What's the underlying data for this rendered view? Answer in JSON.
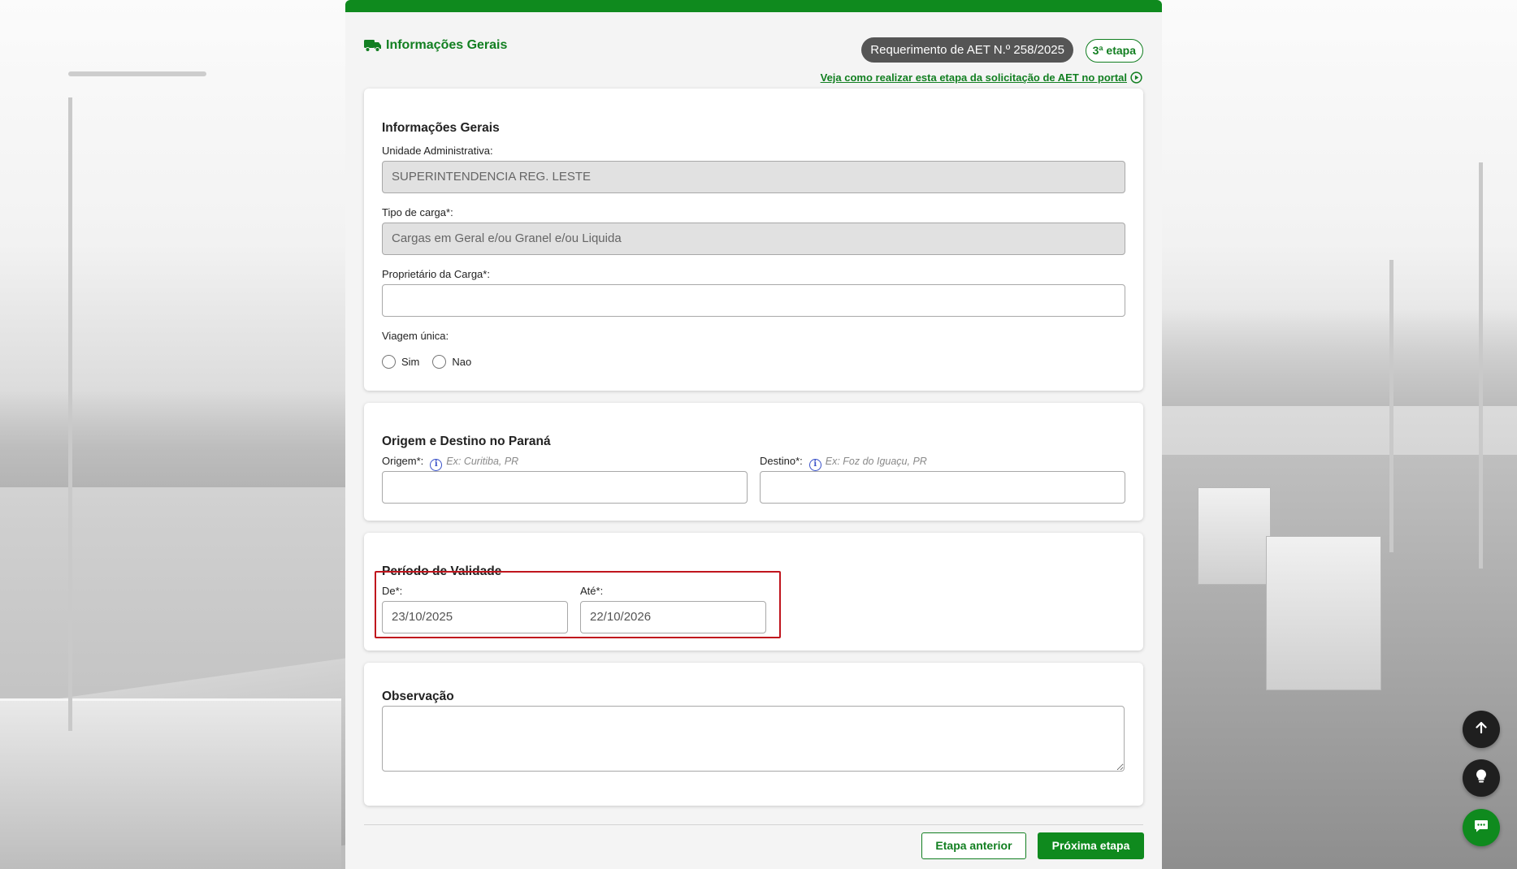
{
  "header": {
    "section_title": "Informações Gerais",
    "request_badge": "Requerimento de AET N.º 258/2025",
    "step_badge": "3ª etapa",
    "help_link": "Veja como realizar esta etapa da solicitação de AET no portal"
  },
  "general_info": {
    "title": "Informações Gerais",
    "admin_unit_label": "Unidade Administrativa:",
    "admin_unit_value": "SUPERINTENDENCIA REG. LESTE",
    "cargo_type_label": "Tipo de carga*:",
    "cargo_type_value": "Cargas em Geral e/ou Granel e/ou Liquida",
    "cargo_owner_label": "Proprietário da Carga*:",
    "cargo_owner_value": "",
    "single_trip_label": "Viagem única:",
    "single_trip_options": [
      "Sim",
      "Nao"
    ]
  },
  "route": {
    "title": "Origem e Destino no Paraná",
    "origin_label": "Origem*:",
    "origin_hint": "Ex: Curitiba, PR",
    "destination_label": "Destino*:",
    "destination_hint": "Ex: Foz do Iguaçu, PR"
  },
  "validity": {
    "title": "Período de Validade",
    "from_label": "De*:",
    "from_value": "23/10/2025",
    "to_label": "Até*:",
    "to_value": "22/10/2026"
  },
  "notes": {
    "title": "Observação"
  },
  "footer": {
    "prev_label": "Etapa anterior",
    "next_label": "Próxima etapa"
  },
  "colors": {
    "brand_green": "#0f8a1e",
    "badge_gray": "#555555",
    "highlight_red": "#c0151d"
  },
  "icons": [
    "truck-icon",
    "play-circle-icon",
    "info-icon",
    "arrow-up-icon",
    "lightbulb-icon",
    "chat-icon"
  ]
}
